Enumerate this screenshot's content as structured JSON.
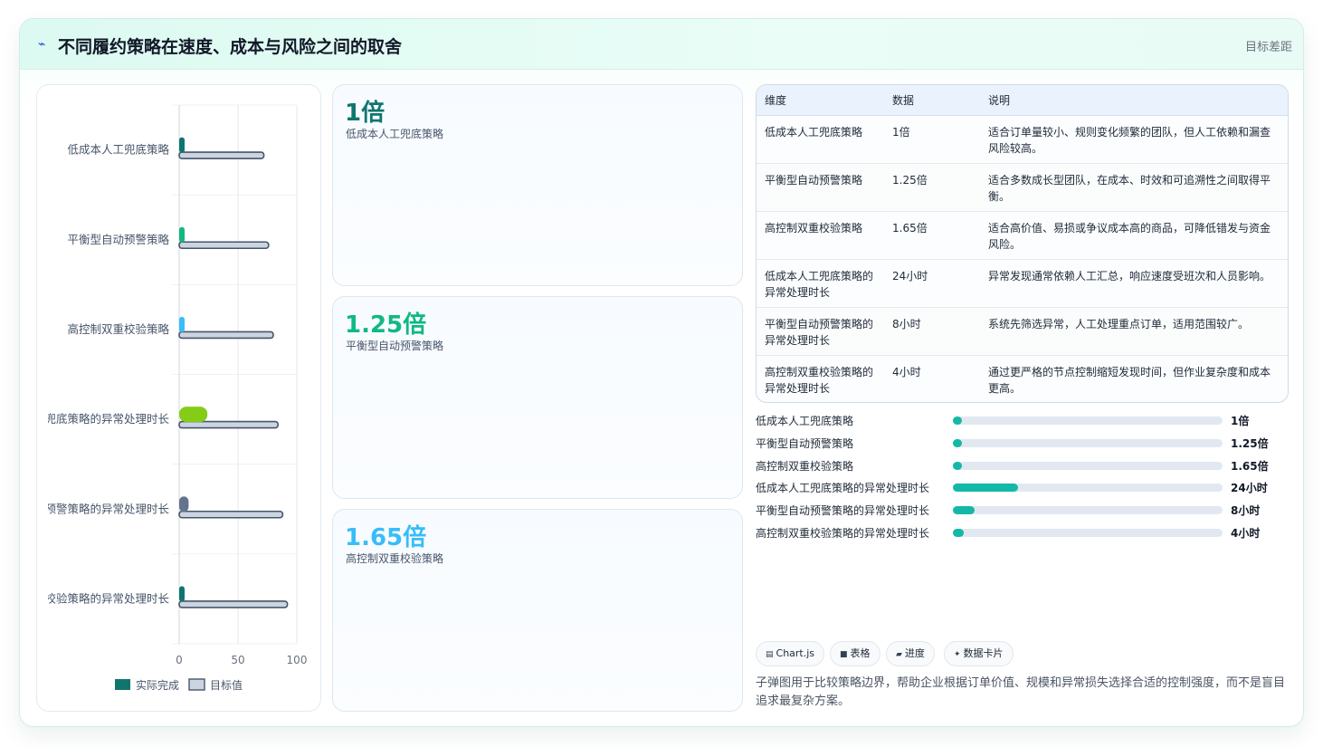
{
  "header": {
    "icon": "chart-line-icon",
    "title": "不同履约策略在速度、成本与风险之间的取舍",
    "right_tag": "目标差距"
  },
  "kpis": [
    {
      "value": "1倍",
      "label": "低成本人工兜底策略",
      "color": "#0f766e"
    },
    {
      "value": "1.25倍",
      "label": "平衡型自动预警策略",
      "color": "#10b981"
    },
    {
      "value": "1.65倍",
      "label": "高控制双重校验策略",
      "color": "#38bdf8"
    }
  ],
  "table": {
    "headers": [
      "维度",
      "数据",
      "说明"
    ],
    "rows": [
      [
        "低成本人工兜底策略",
        "1倍",
        "适合订单量较小、规则变化频繁的团队，但人工依赖和漏查风险较高。"
      ],
      [
        "平衡型自动预警策略",
        "1.25倍",
        "适合多数成长型团队，在成本、时效和可追溯性之间取得平衡。"
      ],
      [
        "高控制双重校验策略",
        "1.65倍",
        "适合高价值、易损或争议成本高的商品，可降低错发与资金风险。"
      ],
      [
        "低成本人工兜底策略的异常处理时长",
        "24小时",
        "异常发现通常依赖人工汇总，响应速度受班次和人员影响。"
      ],
      [
        "平衡型自动预警策略的异常处理时长",
        "8小时",
        "系统先筛选异常，人工处理重点订单，适用范围较广。"
      ],
      [
        "高控制双重校验策略的异常处理时长",
        "4小时",
        "通过更严格的节点控制缩短发现时间，但作业复杂度和成本更高。"
      ]
    ]
  },
  "progress": {
    "max": 100,
    "rows": [
      {
        "label": "低成本人工兜底策略",
        "value": 1,
        "display": "1倍"
      },
      {
        "label": "平衡型自动预警策略",
        "value": 1.25,
        "display": "1.25倍"
      },
      {
        "label": "高控制双重校验策略",
        "value": 1.65,
        "display": "1.65倍"
      },
      {
        "label": "低成本人工兜底策略的异常处理时长",
        "value": 24,
        "display": "24小时"
      },
      {
        "label": "平衡型自动预警策略的异常处理时长",
        "value": 8,
        "display": "8小时"
      },
      {
        "label": "高控制双重校验策略的异常处理时长",
        "value": 4,
        "display": "4小时"
      }
    ]
  },
  "chips": [
    {
      "icon": "chart-icon",
      "glyph": "▤",
      "label": "Chart.js"
    },
    {
      "icon": "table-icon",
      "glyph": "■",
      "label": "表格"
    },
    {
      "icon": "progress-icon",
      "glyph": "▰",
      "label": "进度"
    },
    {
      "icon": "sparkle-icon",
      "glyph": "✦",
      "label": "数据卡片"
    }
  ],
  "footnote": "子弹图用于比较策略边界，帮助企业根据订单价值、规模和异常损失选择合适的控制强度，而不是盲目追求最复杂方案。",
  "chart_data": {
    "type": "bar",
    "orientation": "horizontal",
    "categories": [
      "低成本人工兜底策略",
      "平衡型自动预警策略",
      "高控制双重校验策略",
      "低成本人工兜底策略的异常处理时长",
      "平衡型自动预警策略的异常处理时长",
      "高控制双重校验策略的异常处理时长"
    ],
    "series": [
      {
        "name": "实际完成",
        "values": [
          1,
          1.25,
          1.65,
          24,
          8,
          4
        ],
        "colors": [
          "#0f766e",
          "#10b981",
          "#38bdf8",
          "#84cc16",
          "#64748b",
          "#0f766e"
        ]
      },
      {
        "name": "目标值",
        "values": [
          72,
          76,
          80,
          84,
          88,
          92
        ],
        "color": "#cbd5e1",
        "border": "#475569"
      }
    ],
    "xlim": [
      0,
      100
    ],
    "xticks": [
      0,
      50,
      100
    ],
    "grid": true,
    "legend_position": "bottom"
  }
}
